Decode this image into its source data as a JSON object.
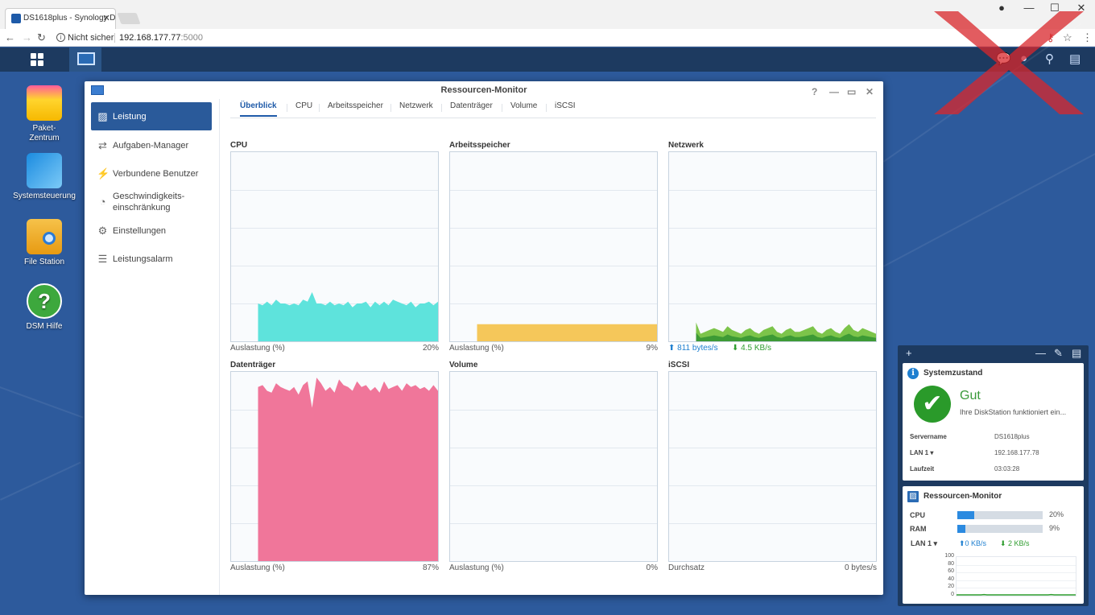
{
  "browser": {
    "tab_title": "DS1618plus - Synology D",
    "tab_close": "✕",
    "not_secure": "Nicht sicher",
    "url_host": "192.168.177.77",
    "url_port": ":5000"
  },
  "desktop": {
    "icons": [
      {
        "label": "Paket-\nZentrum"
      },
      {
        "label": "Systemsteuerung"
      },
      {
        "label": "File Station"
      },
      {
        "label": "DSM Hilfe"
      }
    ]
  },
  "window": {
    "title": "Ressourcen-Monitor",
    "sidebar": [
      {
        "label": "Leistung"
      },
      {
        "label": "Aufgaben-Manager"
      },
      {
        "label": "Verbundene Benutzer"
      },
      {
        "label": "Geschwindigkeits-\neinschränkung"
      },
      {
        "label": "Einstellungen"
      },
      {
        "label": "Leistungsalarm"
      }
    ],
    "tabs": [
      "Überblick",
      "CPU",
      "Arbeitsspeicher",
      "Netzwerk",
      "Datenträger",
      "Volume",
      "iSCSI"
    ],
    "panels": {
      "cpu": {
        "title": "CPU",
        "foot_left": "Auslastung (%)",
        "foot_right": "20%"
      },
      "memory": {
        "title": "Arbeitsspeicher",
        "foot_left": "Auslastung (%)",
        "foot_right": "9%"
      },
      "network": {
        "title": "Netzwerk",
        "up": "811 bytes/s",
        "down": "4.5 KB/s"
      },
      "disk": {
        "title": "Datenträger",
        "foot_left": "Auslastung (%)",
        "foot_right": "87%"
      },
      "volume": {
        "title": "Volume",
        "foot_left": "Auslastung (%)",
        "foot_right": "0%"
      },
      "iscsi": {
        "title": "iSCSI",
        "foot_left": "Durchsatz",
        "foot_right": "0 bytes/s"
      }
    }
  },
  "chart_data": [
    {
      "type": "area",
      "name": "cpu",
      "ylim": [
        0,
        100
      ],
      "color": "#5ee3dc",
      "values": [
        0,
        0,
        0,
        0,
        0,
        0,
        20,
        19,
        21,
        19,
        22,
        20,
        20,
        19,
        20,
        19,
        22,
        21,
        26,
        20,
        20,
        19,
        21,
        19,
        20,
        19,
        21,
        18,
        20,
        20,
        21,
        18,
        21,
        19,
        21,
        19,
        22,
        21,
        20,
        19,
        21,
        18,
        20,
        20,
        21,
        19,
        21
      ]
    },
    {
      "type": "area",
      "name": "memory",
      "ylim": [
        0,
        100
      ],
      "color": "#f5c75a",
      "values": [
        0,
        0,
        0,
        0,
        0,
        0,
        9,
        9,
        9,
        9,
        9,
        9,
        9,
        9,
        9,
        9,
        9,
        9,
        9,
        9,
        9,
        9,
        9,
        9,
        9,
        9,
        9,
        9,
        9,
        9,
        9,
        9,
        9,
        9,
        9,
        9,
        9,
        9,
        9,
        9,
        9,
        9,
        9,
        9,
        9,
        9,
        9
      ]
    },
    {
      "type": "area",
      "name": "network",
      "ylim": [
        0,
        100
      ],
      "color": "#7cc44a",
      "values": [
        0,
        0,
        0,
        0,
        0,
        0,
        10,
        4,
        5,
        6,
        7,
        6,
        5,
        8,
        6,
        5,
        4,
        6,
        7,
        5,
        4,
        6,
        7,
        8,
        5,
        4,
        6,
        7,
        5,
        5,
        6,
        7,
        8,
        5,
        4,
        6,
        7,
        5,
        4,
        7,
        9,
        6,
        5,
        7,
        6,
        5,
        4
      ]
    },
    {
      "type": "area",
      "name": "disk",
      "ylim": [
        0,
        100
      ],
      "color": "#f0769a",
      "values": [
        0,
        0,
        0,
        0,
        0,
        0,
        92,
        93,
        90,
        89,
        94,
        92,
        91,
        90,
        92,
        88,
        93,
        95,
        81,
        97,
        94,
        90,
        92,
        89,
        96,
        93,
        92,
        90,
        95,
        92,
        93,
        90,
        92,
        89,
        95,
        91,
        92,
        93,
        90,
        94,
        92,
        93,
        91,
        92,
        90,
        93,
        90
      ]
    },
    {
      "type": "area",
      "name": "volume",
      "ylim": [
        0,
        100
      ],
      "color": "#3a8de0",
      "values": [
        0,
        0,
        0,
        0,
        0,
        0,
        0,
        0,
        0,
        0,
        0,
        0,
        0,
        0,
        0,
        0,
        0,
        0,
        0,
        0,
        0,
        0,
        0,
        0,
        0,
        0,
        0,
        0,
        0,
        0,
        0,
        0,
        0,
        0,
        0,
        0,
        0,
        0,
        0,
        0,
        0,
        0,
        0,
        0,
        0,
        0,
        0
      ]
    },
    {
      "type": "area",
      "name": "iscsi",
      "ylim": [
        0,
        100
      ],
      "color": "#3a8de0",
      "values": [
        0,
        0,
        0,
        0,
        0,
        0,
        0,
        0,
        0,
        0,
        0,
        0,
        0,
        0,
        0,
        0,
        0,
        0,
        0,
        0,
        0,
        0,
        0,
        0,
        0,
        0,
        0,
        0,
        0,
        0,
        0,
        0,
        0,
        0,
        0,
        0,
        0,
        0,
        0,
        0,
        0,
        0,
        0,
        0,
        0,
        0,
        0
      ]
    },
    {
      "type": "line",
      "name": "mini-network",
      "ylim": [
        0,
        100
      ],
      "yticks": [
        "100",
        "80",
        "60",
        "40",
        "20",
        "0"
      ],
      "values": [
        2,
        2,
        2,
        2,
        2,
        2,
        2,
        2,
        2,
        3,
        2,
        2,
        2,
        2,
        2,
        2,
        2,
        2,
        2,
        2,
        2,
        2,
        2,
        2,
        2,
        2,
        2,
        2,
        2,
        2,
        2,
        3,
        2,
        2,
        2,
        2,
        2,
        2,
        2,
        2
      ]
    }
  ],
  "widgets": {
    "system": {
      "title": "Systemzustand",
      "status": "Gut",
      "desc": "Ihre DiskStation funktioniert ein...",
      "rows": [
        {
          "label": "Servername",
          "value": "DS1618plus"
        },
        {
          "label": "LAN 1 ▾",
          "value": "192.168.177.78"
        },
        {
          "label": "Laufzeit",
          "value": "03:03:28"
        }
      ]
    },
    "resource": {
      "title": "Ressourcen-Monitor",
      "cpu_label": "CPU",
      "cpu_value": "20%",
      "cpu_fraction": 0.2,
      "ram_label": "RAM",
      "ram_value": "9%",
      "ram_fraction": 0.09,
      "lan_label": "LAN 1 ▾",
      "lan_up": "0 KB/s",
      "lan_down": "2 KB/s"
    }
  }
}
